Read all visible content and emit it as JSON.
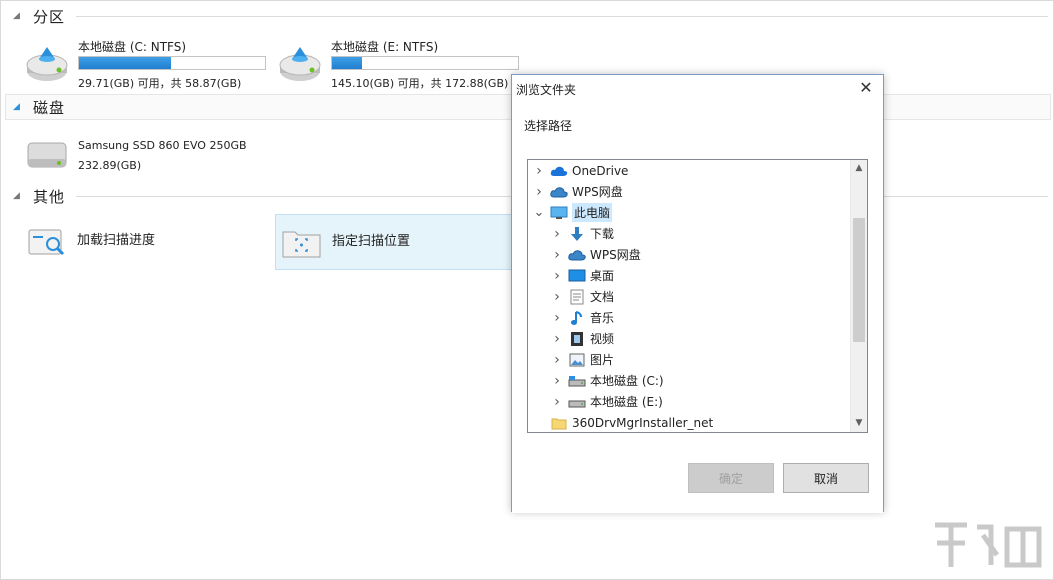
{
  "sections": {
    "partitions": "分区",
    "disks": "磁盘",
    "others": "其他"
  },
  "partitions": [
    {
      "name": "本地磁盘 (C: NTFS)",
      "capacity": "29.71(GB) 可用，共 58.87(GB)",
      "used_fraction": 0.495
    },
    {
      "name": "本地磁盘 (E: NTFS)",
      "capacity": "145.10(GB) 可用，共 172.88(GB)",
      "used_fraction": 0.16
    }
  ],
  "disks": [
    {
      "name": "Samsung SSD 860 EVO 250GB",
      "size": "232.89(GB)"
    }
  ],
  "others": [
    {
      "label": "加载扫描进度",
      "icon": "load-scan-icon"
    },
    {
      "label": "指定扫描位置",
      "icon": "scan-location-icon"
    }
  ],
  "dialog": {
    "title": "浏览文件夹",
    "prompt": "选择路径",
    "ok": "确定",
    "cancel": "取消",
    "tree": [
      {
        "label": "OneDrive",
        "icon": "onedrive-icon",
        "level": 0,
        "expanded": false
      },
      {
        "label": "WPS网盘",
        "icon": "wps-cloud-icon",
        "level": 0,
        "expanded": false
      },
      {
        "label": "此电脑",
        "icon": "computer-icon",
        "level": 0,
        "expanded": true,
        "selected": true
      },
      {
        "label": "下载",
        "icon": "download-icon",
        "level": 1,
        "expanded": false
      },
      {
        "label": "WPS网盘",
        "icon": "wps-cloud-icon",
        "level": 1,
        "expanded": false
      },
      {
        "label": "桌面",
        "icon": "desktop-icon",
        "level": 1,
        "expanded": false
      },
      {
        "label": "文档",
        "icon": "document-icon",
        "level": 1,
        "expanded": false
      },
      {
        "label": "音乐",
        "icon": "music-icon",
        "level": 1,
        "expanded": false
      },
      {
        "label": "视频",
        "icon": "video-icon",
        "level": 1,
        "expanded": false
      },
      {
        "label": "图片",
        "icon": "picture-icon",
        "level": 1,
        "expanded": false
      },
      {
        "label": "本地磁盘 (C:)",
        "icon": "drive-c-icon",
        "level": 1,
        "expanded": false
      },
      {
        "label": "本地磁盘 (E:)",
        "icon": "drive-icon",
        "level": 1,
        "expanded": false
      },
      {
        "label": "360DrvMgrInstaller_net",
        "icon": "folder-icon",
        "level": 0,
        "expanded": null
      }
    ]
  },
  "colors": {
    "accent": "#1f7fd0",
    "selected_tile": "#e5f3fb",
    "tree_selection": "#cce8ff"
  }
}
